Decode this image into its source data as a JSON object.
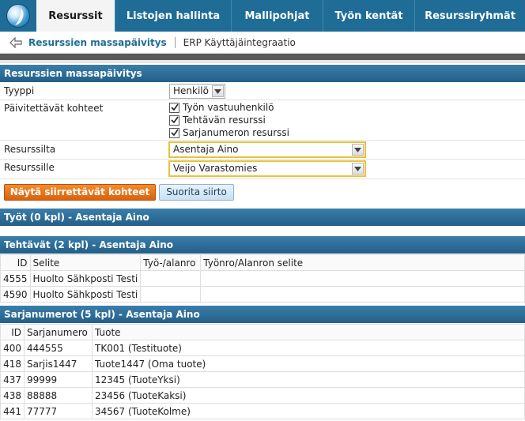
{
  "nav": {
    "tabs": [
      {
        "label": "Resurssit",
        "active": true
      },
      {
        "label": "Listojen hallinta",
        "active": false
      },
      {
        "label": "Mallipohjat",
        "active": false
      },
      {
        "label": "Työn kentät",
        "active": false
      },
      {
        "label": "Resurssiryhmät",
        "active": false
      }
    ]
  },
  "subnav": {
    "active_label": "Resurssien massapäivitys",
    "other_label": "ERP Käyttäjäintegraatio"
  },
  "form": {
    "section_title": "Resurssien massapäivitys",
    "type_label": "Tyyppi",
    "type_value": "Henkilö",
    "targets_label": "Päivitettävät kohteet",
    "targets": [
      {
        "label": "Työn vastuuhenkilö",
        "checked": true
      },
      {
        "label": "Tehtävän resurssi",
        "checked": true
      },
      {
        "label": "Sarjanumeron resurssi",
        "checked": true
      }
    ],
    "from_label": "Resurssilta",
    "from_value": "Asentaja Aino",
    "to_label": "Resurssille",
    "to_value": "Veijo Varastomies",
    "show_button": "Näytä siirrettävät kohteet",
    "run_button": "Suorita siirto"
  },
  "jobs": {
    "title": "Työt (0 kpl) - Asentaja Aino"
  },
  "tasks": {
    "title": "Tehtävät (2 kpl) - Asentaja Aino",
    "columns": [
      "ID",
      "Selite",
      "Työ-/alanro",
      "Työnro/Alanron selite"
    ],
    "rows": [
      [
        "4555",
        "Huolto Sähkposti Testi",
        "",
        ""
      ],
      [
        "4590",
        "Huolto Sähkposti Testi",
        "",
        ""
      ]
    ]
  },
  "serials": {
    "title": "Sarjanumerot (5 kpl) - Asentaja Aino",
    "columns": [
      "ID",
      "Sarjanumero",
      "Tuote"
    ],
    "rows": [
      [
        "400",
        "444555",
        "TK001 (Testituote)"
      ],
      [
        "418",
        "Sarjis1447",
        "Tuote1447 (Oma tuote)"
      ],
      [
        "437",
        "99999",
        "12345 (TuoteYksi)"
      ],
      [
        "438",
        "88888",
        "23456 (TuoteKaksi)"
      ],
      [
        "441",
        "77777",
        "34567 (TuoteKolme)"
      ]
    ]
  },
  "colors": {
    "nav_bg": "#1f6d97",
    "section_header": "#2d6e98",
    "accent_orange": "#e8751a",
    "highlight_border": "#e8c23a"
  }
}
